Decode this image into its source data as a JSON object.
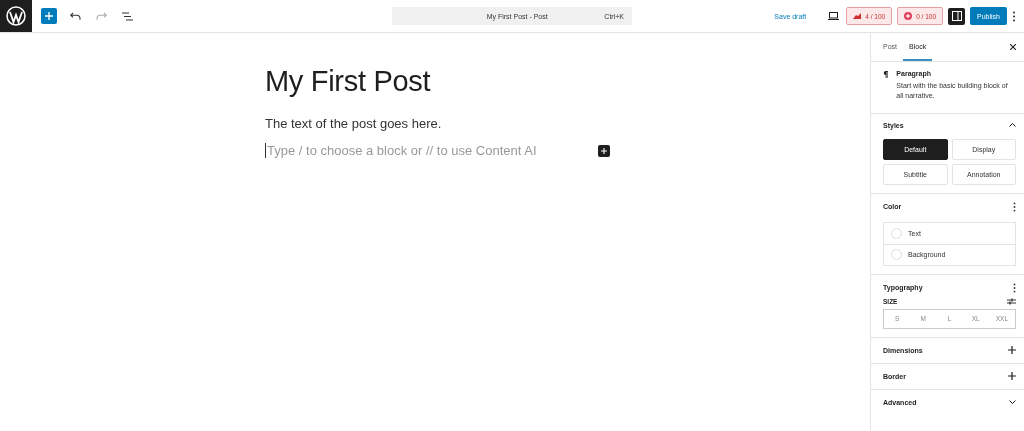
{
  "toolbar": {
    "document_title": "My First Post - Post",
    "shortcut": "Ctrl+K",
    "save_draft": "Save draft",
    "scores": [
      {
        "kind": "seo",
        "text": "4 / 100"
      },
      {
        "kind": "readability",
        "text": "0 / 100"
      }
    ],
    "settings_open": true,
    "publish": "Publish"
  },
  "editor": {
    "title": "My First Post",
    "paragraph": "The text of the post goes here.",
    "placeholder": "Type / to choose a block or // to use Content AI"
  },
  "sidebar": {
    "tabs": [
      {
        "label": "Post",
        "selected": false
      },
      {
        "label": "Block",
        "selected": true
      }
    ],
    "block": {
      "name": "Paragraph",
      "description": "Start with the basic building block of all narrative."
    },
    "styles": {
      "title": "Styles",
      "expanded": true,
      "options": [
        {
          "label": "Default",
          "selected": true
        },
        {
          "label": "Display",
          "selected": false
        },
        {
          "label": "Subtitle",
          "selected": false
        },
        {
          "label": "Annotation",
          "selected": false
        }
      ]
    },
    "color": {
      "title": "Color",
      "items": [
        "Text",
        "Background"
      ]
    },
    "typography": {
      "title": "Typography",
      "size_label": "SIZE",
      "sizes": [
        "S",
        "M",
        "L",
        "XL",
        "XXL"
      ]
    },
    "panels": [
      {
        "title": "Dimensions",
        "kind": "add"
      },
      {
        "title": "Border",
        "kind": "add"
      },
      {
        "title": "Advanced",
        "kind": "collapse"
      }
    ]
  }
}
